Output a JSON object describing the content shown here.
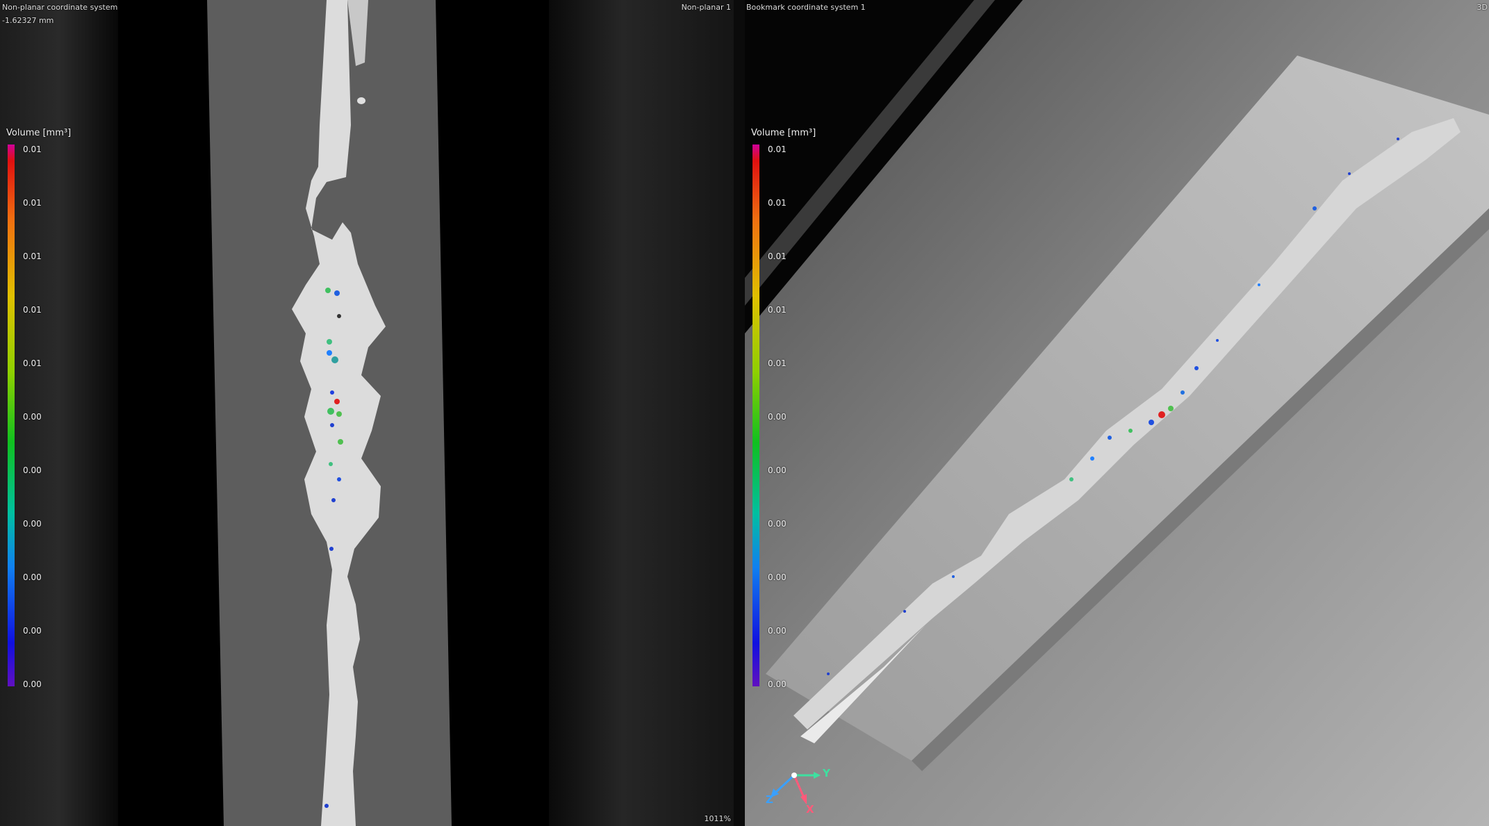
{
  "left_view": {
    "coord_system": "Non-planar coordinate system",
    "offset": "-1.62327 mm",
    "view_name": "Non-planar 1",
    "zoom": "1011%"
  },
  "right_view": {
    "coord_system": "Bookmark coordinate system 1",
    "view_mode": "3D"
  },
  "legend": {
    "title": "Volume [mm³]",
    "ticks": [
      "0.01",
      "0.01",
      "0.01",
      "0.01",
      "0.01",
      "0.00",
      "0.00",
      "0.00",
      "0.00",
      "0.00",
      "0.00"
    ]
  },
  "axes": {
    "x": "X",
    "y": "Y",
    "z": "Z"
  },
  "colors": {
    "axis_x": "#ff5a7a",
    "axis_y": "#3ee0a0",
    "axis_z": "#3aa0ff"
  }
}
